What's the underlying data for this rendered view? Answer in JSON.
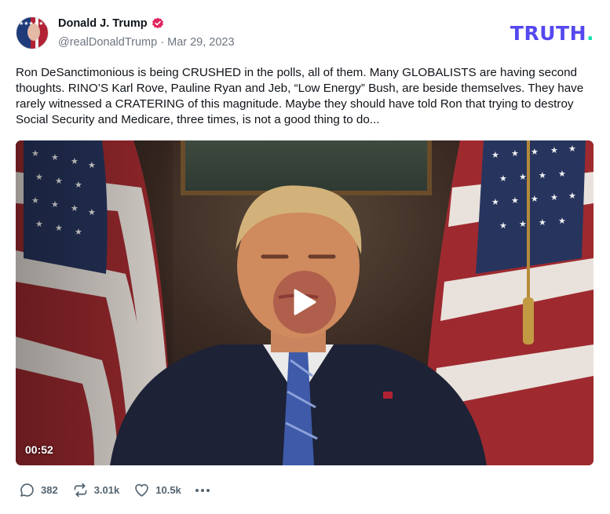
{
  "post": {
    "author_name": "Donald J. Trump",
    "handle": "@realDonaldTrump",
    "separator": "·",
    "date": "Mar 29, 2023",
    "text": "Ron DeSanctimonious is being CRUSHED in the polls, all of them. Many GLOBALISTS are having second thoughts. RINO’S Karl Rove, Pauline Ryan and Jeb, “Low Energy” Bush, are beside themselves. They have rarely witnessed a CRATERING of this magnitude. Maybe they should have told Ron that trying to destroy Social Security and Medicare, three times, is not a good thing to do..."
  },
  "brand": {
    "logo_text": "TRUTH",
    "logo_dot": ".",
    "logo_color": "#5448ee",
    "dot_color": "#17e0b0"
  },
  "video": {
    "duration": "00:52"
  },
  "actions": {
    "replies": "382",
    "retruths": "3.01k",
    "likes": "10.5k"
  },
  "icons": {
    "verified": "verified-badge-icon",
    "play": "play-icon",
    "reply": "comment-icon",
    "retruth": "repost-icon",
    "like": "heart-icon",
    "more": "more-dots-icon"
  },
  "colors": {
    "verified_badge": "#e0245e",
    "muted_text": "#6e7681"
  }
}
